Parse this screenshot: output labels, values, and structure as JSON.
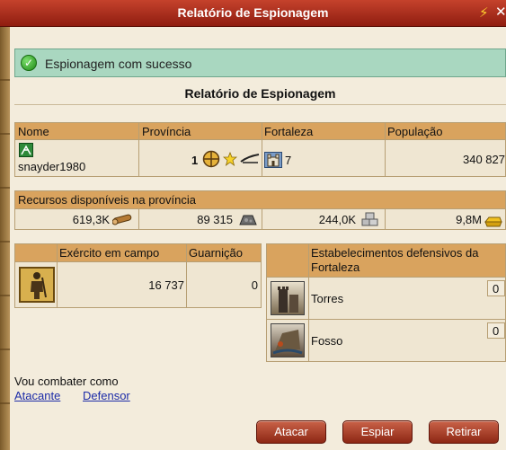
{
  "window": {
    "title": "Relatório de Espionagem"
  },
  "success": {
    "message": "Espionagem com sucesso"
  },
  "report": {
    "title": "Relatório de Espionagem"
  },
  "target": {
    "headers": {
      "name": "Nome",
      "province": "Província",
      "fortress": "Fortaleza",
      "population": "População"
    },
    "name": "snayder1980",
    "province_level": "1",
    "fortress_level": "7",
    "population": "340 827"
  },
  "resources": {
    "title": "Recursos disponíveis na província",
    "wood": "619,3K",
    "iron": "89 315",
    "stone": "244,0K",
    "gold": "9,8M"
  },
  "army": {
    "header_field": "Exército em campo",
    "header_garrison": "Guarnição",
    "field": "16 737",
    "garrison": "0"
  },
  "defenses": {
    "title": "Estabelecimentos defensivos da Fortaleza",
    "items": [
      {
        "name": "Torres",
        "level": "0"
      },
      {
        "name": "Fosso",
        "level": "0"
      }
    ]
  },
  "combat": {
    "prompt": "Vou combater como",
    "attacker": "Atacante",
    "defender": "Defensor"
  },
  "buttons": {
    "attack": "Atacar",
    "spy": "Espiar",
    "retreat": "Retirar"
  },
  "colors": {
    "titlebar": "#b33a24",
    "header": "#d9a35e",
    "success": "#a9d7c0"
  }
}
